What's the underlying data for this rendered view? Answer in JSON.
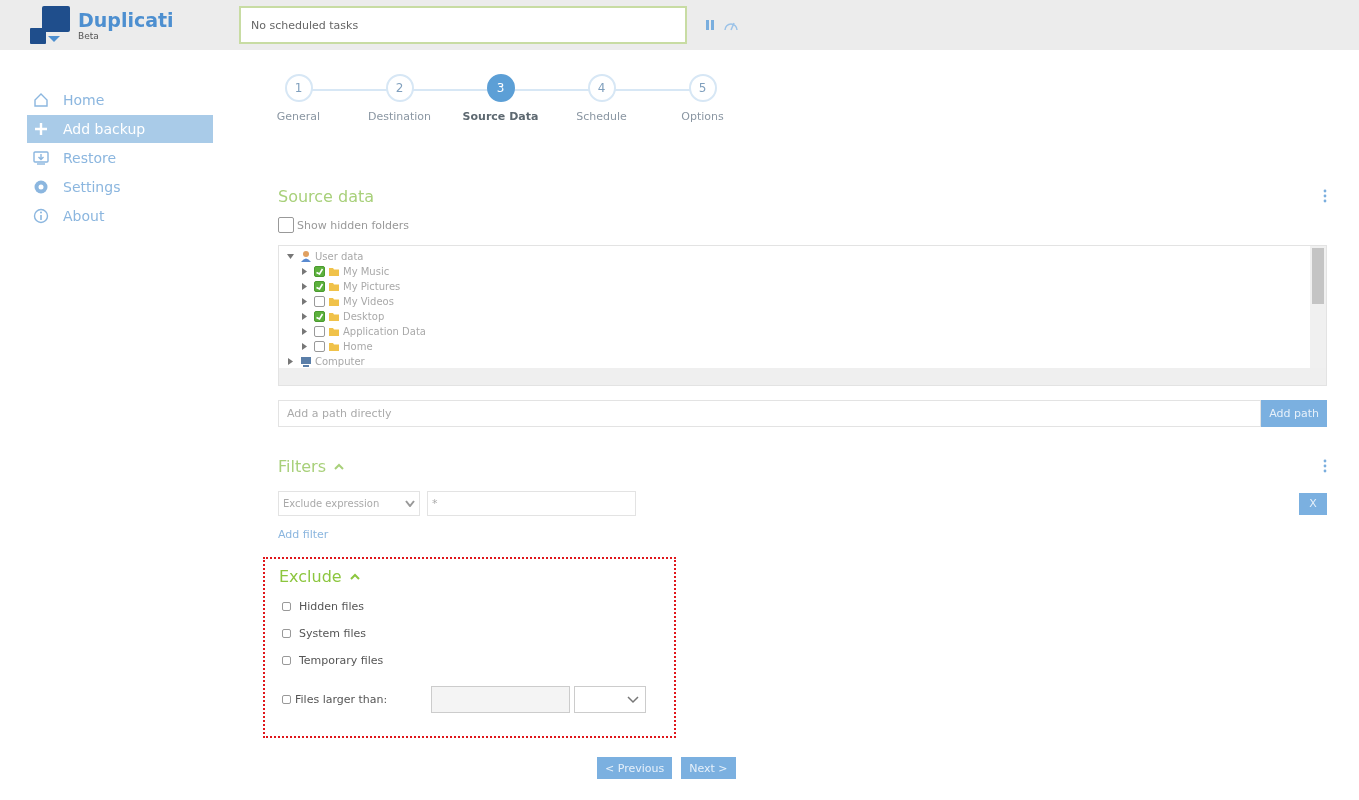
{
  "header": {
    "app_name": "Duplicati",
    "edition": "Beta",
    "status": "No scheduled tasks"
  },
  "sidebar": {
    "items": [
      {
        "label": "Home",
        "selected": false
      },
      {
        "label": "Add backup",
        "selected": true
      },
      {
        "label": "Restore",
        "selected": false
      },
      {
        "label": "Settings",
        "selected": false
      },
      {
        "label": "About",
        "selected": false
      }
    ]
  },
  "steps": [
    {
      "number": "1",
      "label": "General",
      "selected": false
    },
    {
      "number": "2",
      "label": "Destination",
      "selected": false
    },
    {
      "number": "3",
      "label": "Source Data",
      "selected": true
    },
    {
      "number": "4",
      "label": "Schedule",
      "selected": false
    },
    {
      "number": "5",
      "label": "Options",
      "selected": false
    }
  ],
  "source_data": {
    "title": "Source data",
    "show_hidden_folders": {
      "label": "Show hidden folders",
      "checked": false
    },
    "tree": [
      {
        "label": "User data",
        "expanded": true,
        "children": [
          {
            "label": "My Music",
            "checked": true
          },
          {
            "label": "My Pictures",
            "checked": true
          },
          {
            "label": "My Videos",
            "checked": false
          },
          {
            "label": "Desktop",
            "checked": true
          },
          {
            "label": "Application Data",
            "checked": false
          },
          {
            "label": "Home",
            "checked": false
          }
        ]
      },
      {
        "label": "Computer",
        "expanded": false
      }
    ],
    "path_field": {
      "placeholder": "Add a path directly"
    },
    "add_path_button": "Add path"
  },
  "filters": {
    "title": "Filters",
    "expanded": true,
    "rows": [
      {
        "type": "Exclude expression",
        "value": "*"
      }
    ],
    "remove_button": "X",
    "add_filter": "Add filter"
  },
  "exclude": {
    "title": "Exclude",
    "expanded": true,
    "options": [
      {
        "label": "Hidden files",
        "checked": false
      },
      {
        "label": "System files",
        "checked": false
      },
      {
        "label": "Temporary files",
        "checked": false
      }
    ],
    "size_limit": {
      "label": "Files larger than:",
      "checked": false
    }
  },
  "nav_buttons": {
    "previous": "< Previous",
    "next": "Next >"
  }
}
